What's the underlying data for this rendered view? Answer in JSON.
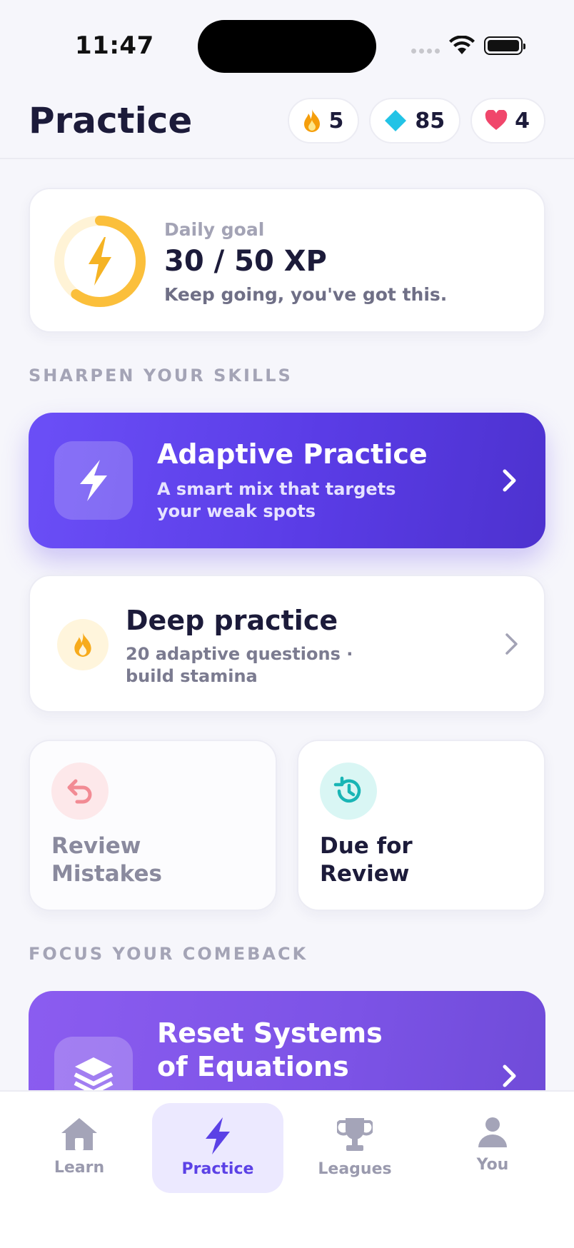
{
  "status_bar": {
    "time": "11:47"
  },
  "header": {
    "title": "Practice",
    "stats": [
      {
        "icon": "flame-icon",
        "value": "5"
      },
      {
        "icon": "gem-icon",
        "value": "85"
      },
      {
        "icon": "heart-icon",
        "value": "4"
      }
    ]
  },
  "daily_goal": {
    "label": "Daily goal",
    "value": "30 / 50 XP",
    "message": "Keep going, you've got this.",
    "progress": 0.6
  },
  "sections": {
    "skills_label": "SHARPEN YOUR SKILLS",
    "comeback_label": "FOCUS YOUR COMEBACK"
  },
  "adaptive_practice": {
    "title": "Adaptive Practice",
    "subtitle": "A smart mix that targets your weak spots"
  },
  "deep_practice": {
    "title": "Deep practice",
    "subtitle": "20 adaptive questions · build stamina"
  },
  "review_mistakes": {
    "title": "Review Mistakes"
  },
  "due_for_review": {
    "title": "Due for Review"
  },
  "comeback": {
    "title": "Reset Systems of Equations"
  },
  "tabs": [
    {
      "label": "Learn",
      "icon": "home-icon"
    },
    {
      "label": "Practice",
      "icon": "bolt-icon",
      "active": true
    },
    {
      "label": "Leagues",
      "icon": "trophy-icon"
    },
    {
      "label": "You",
      "icon": "person-icon"
    }
  ],
  "colors": {
    "accent": "#5b41e6",
    "goal_ring": "#fbbf3b",
    "flame": "#f59e0b",
    "gem": "#22c3e6",
    "heart": "#f0466b",
    "review_mistakes": "#f28b94",
    "due_review": "#19b5b5"
  }
}
